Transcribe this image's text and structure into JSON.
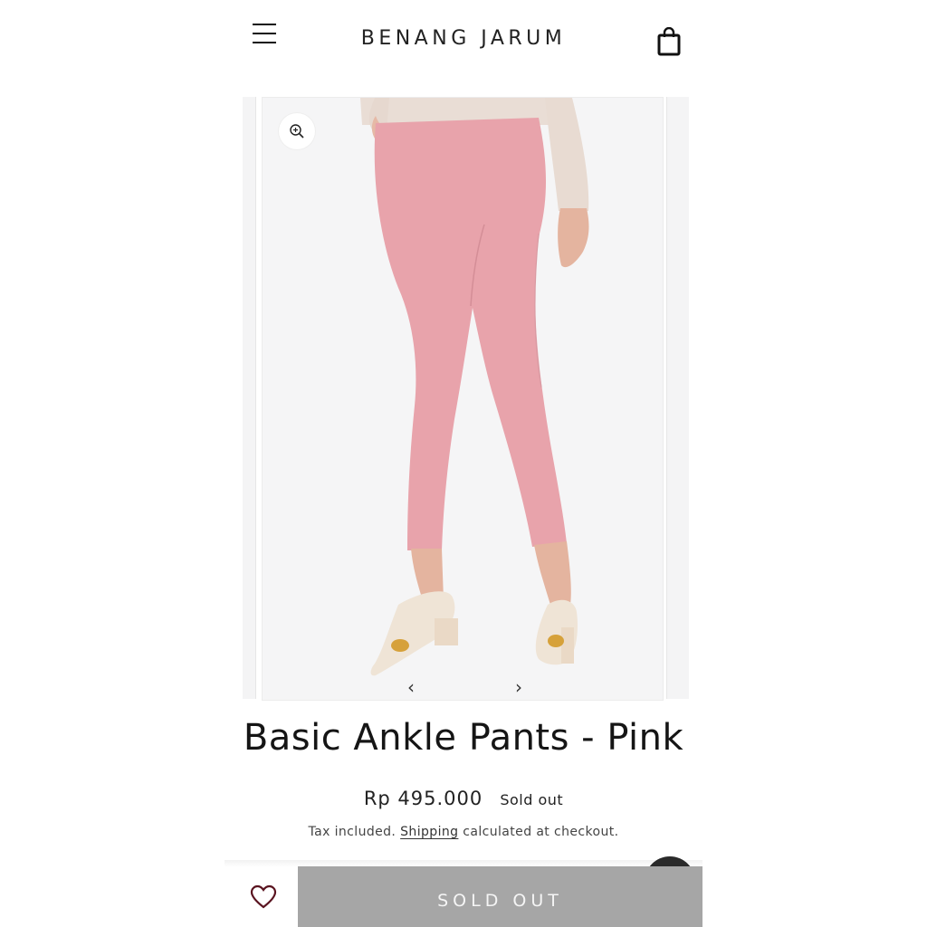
{
  "header": {
    "logo": "BENANG JARUM",
    "menu_icon": "hamburger-menu-icon",
    "cart_icon": "shopping-bag-icon"
  },
  "gallery": {
    "zoom_icon": "zoom-in-icon",
    "prev_glyph": "‹",
    "next_glyph": "›",
    "pants_color": "#e8a3ab",
    "sweater_color": "#e9ddd5",
    "shoe_color": "#efe4d6"
  },
  "product": {
    "title": "Basic Ankle Pants - Pink",
    "price": "Rp 495.000",
    "badge": "Sold out",
    "tax_prefix": "Tax included.",
    "tax_link": "Shipping",
    "tax_suffix": "calculated at checkout."
  },
  "actions": {
    "wishlist_icon": "heart-icon",
    "soldout_label": "SOLD OUT",
    "chat_icon": "chat-icon"
  }
}
